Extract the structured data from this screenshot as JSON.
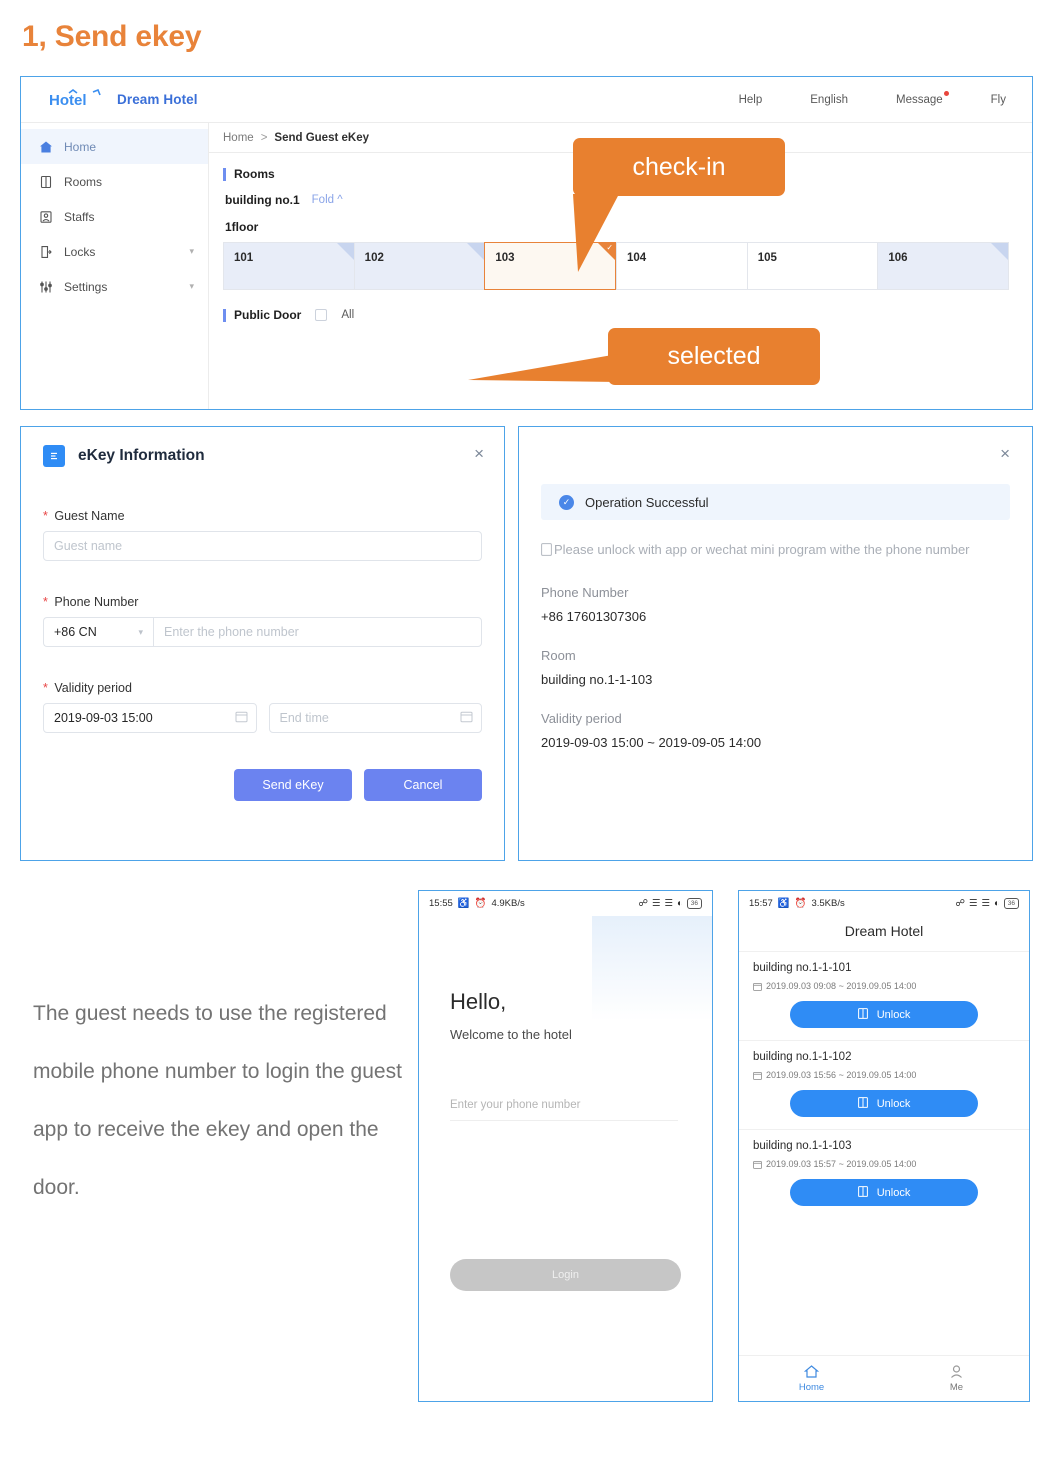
{
  "page": {
    "title": "1, Send ekey",
    "accent_orange": "#e8802f",
    "accent_blue": "#4da3e8"
  },
  "webapp": {
    "brand": "Dream Hotel",
    "logo_text": "Hotel",
    "topnav": [
      {
        "label": "Help",
        "badge": false
      },
      {
        "label": "English",
        "badge": false
      },
      {
        "label": "Message",
        "badge": true
      },
      {
        "label": "Fly",
        "badge": false
      }
    ],
    "sidebar": [
      {
        "label": "Home",
        "icon": "home-icon",
        "active": true,
        "chevron": false
      },
      {
        "label": "Rooms",
        "icon": "door-icon",
        "active": false,
        "chevron": false
      },
      {
        "label": "Staffs",
        "icon": "staff-icon",
        "active": false,
        "chevron": false
      },
      {
        "label": "Locks",
        "icon": "lock-icon",
        "active": false,
        "chevron": true
      },
      {
        "label": "Settings",
        "icon": "sliders-icon",
        "active": false,
        "chevron": true
      }
    ],
    "breadcrumb": {
      "home": "Home",
      "separator": ">",
      "current": "Send Guest eKey"
    },
    "rooms_section": {
      "title": "Rooms",
      "building": "building no.1",
      "fold_label": "Fold",
      "floor": "1floor",
      "rooms": [
        {
          "no": "101",
          "state": "occupied"
        },
        {
          "no": "102",
          "state": "occupied"
        },
        {
          "no": "103",
          "state": "selected"
        },
        {
          "no": "104",
          "state": "free"
        },
        {
          "no": "105",
          "state": "free"
        },
        {
          "no": "106",
          "state": "occupied"
        }
      ]
    },
    "public_door": {
      "title": "Public Door",
      "all_label": "All",
      "checked": false
    }
  },
  "callouts": {
    "check_in": "check-in",
    "selected": "selected"
  },
  "ekey_dialog": {
    "title": "eKey Information",
    "close": "×",
    "guest_name": {
      "label": "Guest Name",
      "required": "*",
      "placeholder": "Guest name",
      "value": ""
    },
    "phone": {
      "label": "Phone Number",
      "required": "*",
      "country_code": "+86 CN",
      "placeholder": "Enter the phone number",
      "value": ""
    },
    "validity": {
      "label": "Validity period",
      "required": "*",
      "start_value": "2019-09-03 15:00",
      "end_placeholder": "End time",
      "end_value": ""
    },
    "buttons": {
      "send": "Send eKey",
      "cancel": "Cancel"
    }
  },
  "success_dialog": {
    "close": "×",
    "banner": "Operation Successful",
    "hint": "Please unlock with app or wechat mini program withe the phone number",
    "phone_label": "Phone Number",
    "phone_value": "+86 17601307306",
    "room_label": "Room",
    "room_value": "building no.1-1-103",
    "validity_label": "Validity period",
    "validity_value": "2019-09-03 15:00  ~  2019-09-05 14:00"
  },
  "caption": "The guest needs to use the registered mobile phone number to login the guest app to receive the ekey and open the door.",
  "phone_login": {
    "status": {
      "time": "15:55",
      "net_speed": "4.9KB/s",
      "battery": "36"
    },
    "hello": "Hello,",
    "subtitle": "Welcome to the hotel",
    "input_placeholder": "Enter your phone number",
    "login_button": "Login"
  },
  "phone_keys": {
    "status": {
      "time": "15:57",
      "net_speed": "3.5KB/s",
      "battery": "36"
    },
    "title": "Dream Hotel",
    "items": [
      {
        "room": "building no.1-1-101",
        "dates": "2019.09.03 09:08 ~ 2019.09.05 14:00",
        "button": "Unlock"
      },
      {
        "room": "building no.1-1-102",
        "dates": "2019.09.03 15:56 ~ 2019.09.05 14:00",
        "button": "Unlock"
      },
      {
        "room": "building no.1-1-103",
        "dates": "2019.09.03 15:57 ~ 2019.09.05 14:00",
        "button": "Unlock"
      }
    ],
    "tabs": [
      {
        "label": "Home",
        "icon": "home-icon",
        "active": true
      },
      {
        "label": "Me",
        "icon": "person-icon",
        "active": false
      }
    ]
  }
}
